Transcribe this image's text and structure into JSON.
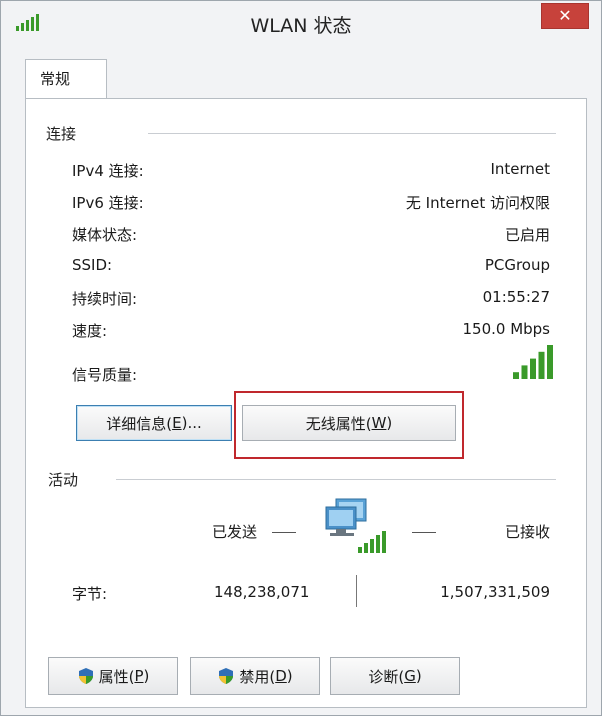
{
  "window": {
    "title": "WLAN 状态",
    "close_label": "✕"
  },
  "tabs": [
    {
      "label": "常规"
    }
  ],
  "connection": {
    "group_title": "连接",
    "rows": [
      {
        "label": "IPv4 连接:",
        "value": "Internet"
      },
      {
        "label": "IPv6 连接:",
        "value": "无 Internet 访问权限"
      },
      {
        "label": "媒体状态:",
        "value": "已启用"
      },
      {
        "label": "SSID:",
        "value": "PCGroup"
      },
      {
        "label": "持续时间:",
        "value": "01:55:27"
      },
      {
        "label": "速度:",
        "value": "150.0 Mbps"
      }
    ],
    "signal_label": "信号质量:",
    "signal_bars_lit": 5,
    "signal_bars_total": 5
  },
  "buttons_mid": {
    "details_label": "详细信息(",
    "details_accel": "E",
    "details_suffix": ")...",
    "wireless_label": "无线属性(",
    "wireless_accel": "W",
    "wireless_suffix": ")"
  },
  "activity": {
    "group_title": "活动",
    "sent_label": "已发送",
    "received_label": "已接收",
    "bytes_label": "字节:",
    "bytes_sent": "148,238,071",
    "bytes_received": "1,507,331,509"
  },
  "buttons_bottom": {
    "properties_label": "属性(",
    "properties_accel": "P",
    "properties_suffix": ")",
    "disable_label": "禁用(",
    "disable_accel": "D",
    "disable_suffix": ")",
    "diagnose_label": "诊断(",
    "diagnose_accel": "G",
    "diagnose_suffix": ")"
  },
  "colors": {
    "signal_green": "#3a9a2a",
    "highlight_red": "#c0282d",
    "close_red": "#c7423b"
  }
}
